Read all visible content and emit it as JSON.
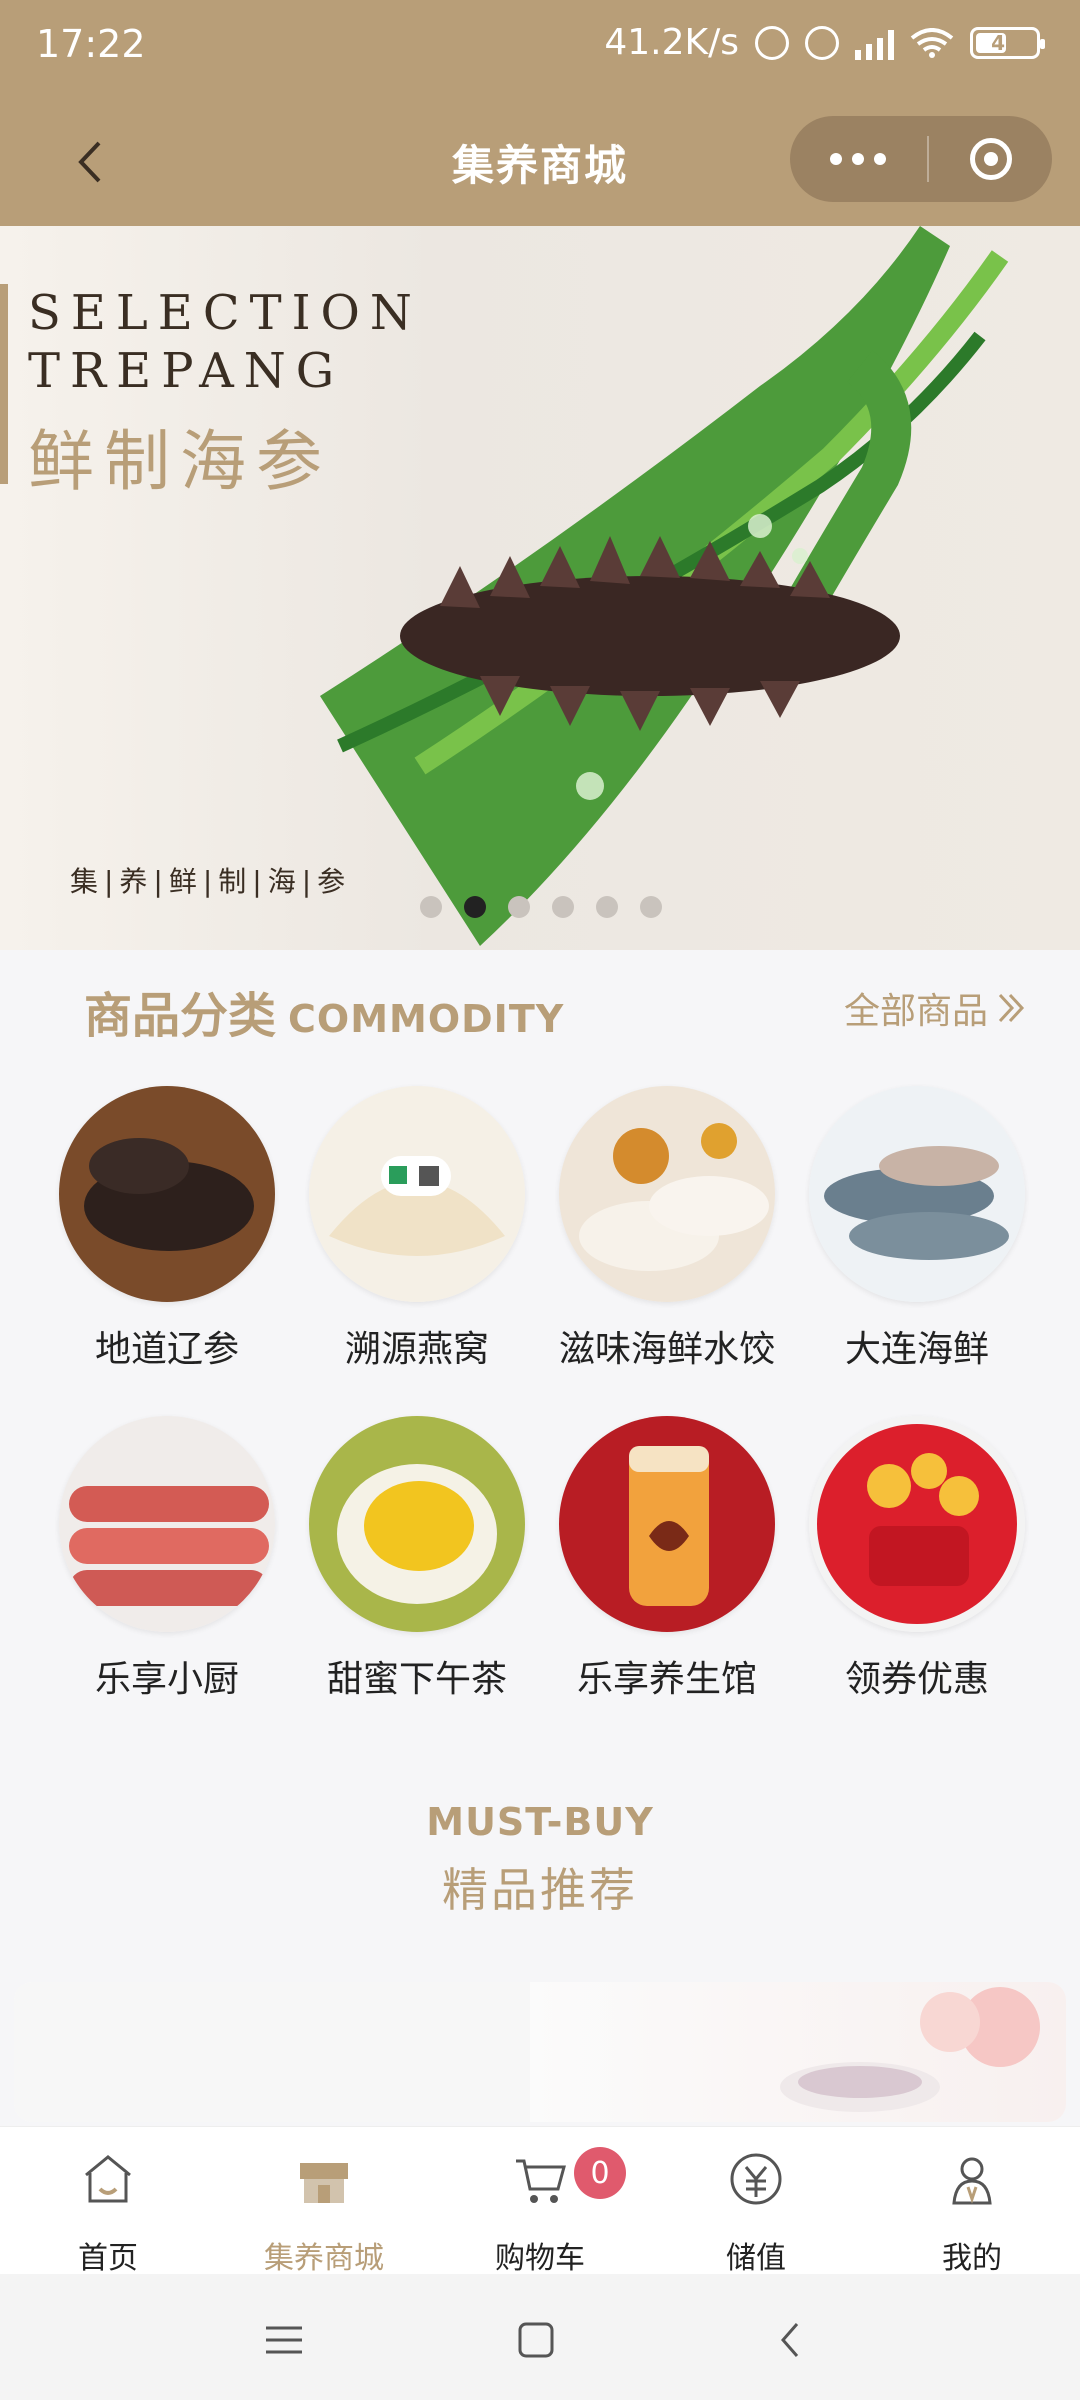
{
  "status_bar": {
    "time": "17:22",
    "network_speed": "41.2K/s",
    "battery": "47",
    "icons": [
      "mute-icon",
      "alarm-icon",
      "signal-icon",
      "wifi-icon",
      "battery-icon"
    ]
  },
  "navbar": {
    "title": "集养商城"
  },
  "banner": {
    "title_en_line1": "SELECTION",
    "title_en_line2": "TREPANG",
    "title_cn": "鲜制海参",
    "subtitle": "集|养|鲜|制|海|参",
    "active_slide": 2,
    "total_slides": 6
  },
  "commodity": {
    "title_cn": "商品分类",
    "title_en": "COMMODITY",
    "see_all": "全部商品",
    "items": [
      {
        "label": "地道辽参",
        "icon": "sea-cucumber"
      },
      {
        "label": "溯源燕窝",
        "icon": "birds-nest"
      },
      {
        "label": "滋味海鲜水饺",
        "icon": "dumplings"
      },
      {
        "label": "大连海鲜",
        "icon": "fish"
      },
      {
        "label": "乐享小厨",
        "icon": "ribs"
      },
      {
        "label": "甜蜜下午茶",
        "icon": "durian"
      },
      {
        "label": "乐享养生馆",
        "icon": "tonic-jar"
      },
      {
        "label": "领券优惠",
        "icon": "coupons"
      }
    ]
  },
  "mustbuy": {
    "title_en": "MUST-BUY",
    "title_cn": "精品推荐"
  },
  "tabbar": {
    "items": [
      {
        "label": "首页",
        "icon": "home-icon"
      },
      {
        "label": "集养商城",
        "icon": "store-icon"
      },
      {
        "label": "购物车",
        "icon": "cart-icon",
        "badge": "0"
      },
      {
        "label": "储值",
        "icon": "yuan-icon"
      },
      {
        "label": "我的",
        "icon": "user-icon"
      }
    ],
    "active_index": 1
  },
  "colors": {
    "brand": "#b89e78",
    "brand_dark": "#9b8262",
    "badge": "#e05a6d",
    "text": "#222222"
  }
}
